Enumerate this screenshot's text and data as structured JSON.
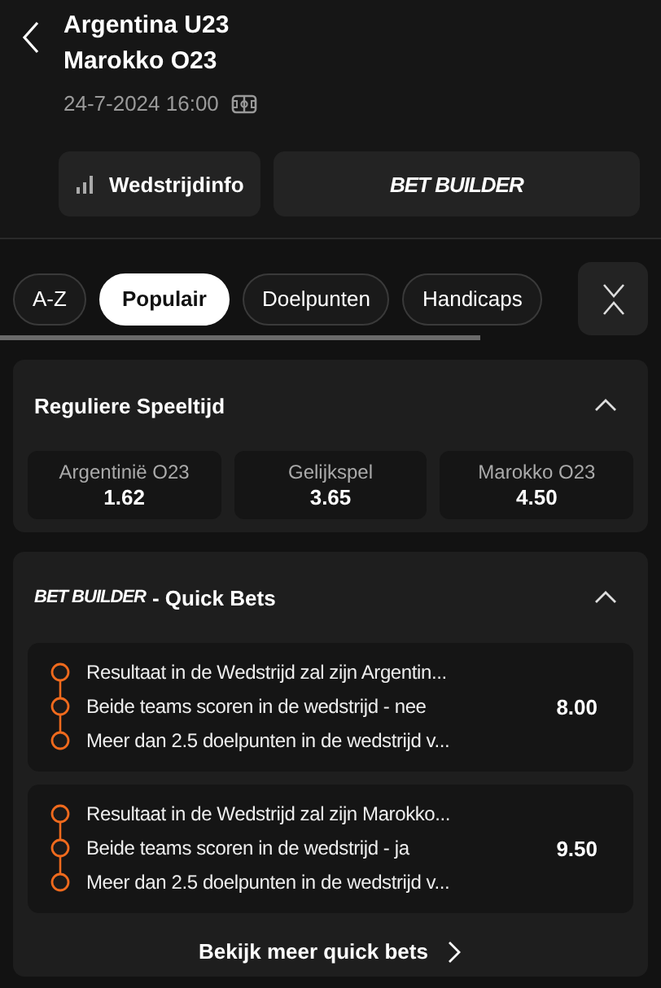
{
  "header": {
    "home_team": "Argentina U23",
    "away_team": "Marokko O23",
    "datetime": "24-7-2024 16:00"
  },
  "actions": [
    {
      "kind": "info",
      "label": "Wedstrijdinfo"
    },
    {
      "kind": "builder",
      "label": "BET BUILDER"
    }
  ],
  "tabs": [
    {
      "label": "A-Z",
      "selected": false
    },
    {
      "label": "Populair",
      "selected": true
    },
    {
      "label": "Doelpunten",
      "selected": false
    },
    {
      "label": "Handicaps",
      "selected": false
    }
  ],
  "market": {
    "title": "Reguliere Speeltijd",
    "expanded": true,
    "outcomes": [
      {
        "label": "Argentinië O23",
        "odds": "1.62"
      },
      {
        "label": "Gelijkspel",
        "odds": "3.65"
      },
      {
        "label": "Marokko O23",
        "odds": "4.50"
      }
    ]
  },
  "quick_bets": {
    "brand": "BET BUILDER",
    "title": "- Quick Bets",
    "expanded": true,
    "bets": [
      {
        "legs": [
          "Resultaat in de Wedstrijd zal zijn Argentin...",
          "Beide teams scoren in de wedstrijd - nee",
          "Meer dan 2.5 doelpunten in de wedstrijd v..."
        ],
        "odds": "8.00"
      },
      {
        "legs": [
          "Resultaat in de Wedstrijd zal zijn Marokko...",
          "Beide teams scoren in de wedstrijd - ja",
          "Meer dan 2.5 doelpunten in de wedstrijd v..."
        ],
        "odds": "9.50"
      }
    ],
    "more_link": "Bekijk meer quick bets"
  }
}
